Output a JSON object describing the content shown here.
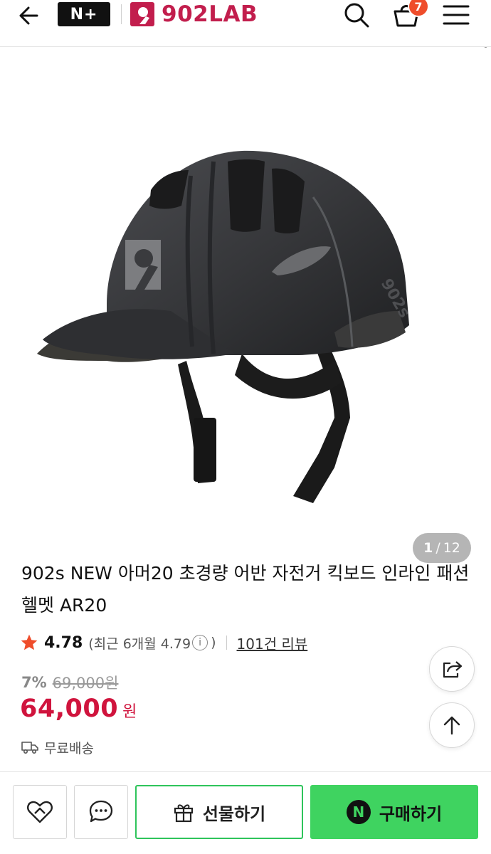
{
  "header": {
    "plus_label": "N+",
    "brand_name": "902LAB",
    "cart_count": "7",
    "accent_color": "#c21e4d"
  },
  "gallery": {
    "current": "1",
    "separator": "/",
    "total": "12",
    "image": "black-bike-helmet"
  },
  "product": {
    "title": "902s NEW 아머20 초경량 어반 자전거 킥보드 인라인 패션 헬멧 AR20",
    "rating": "4.78",
    "recent_rating_prefix": "(최근 6개월 4.79",
    "recent_rating_suffix": ")",
    "info_glyph": "i",
    "review_link": "101건 리뷰",
    "discount_percent": "7%",
    "original_price": "69,000원",
    "price": "64,000",
    "currency": "원",
    "shipping": "무료배송",
    "price_color": "#d0143d"
  },
  "bottom_bar": {
    "gift_label": "선물하기",
    "buy_label": "구매하기",
    "buy_logo": "N",
    "buy_color": "#3fd360"
  }
}
